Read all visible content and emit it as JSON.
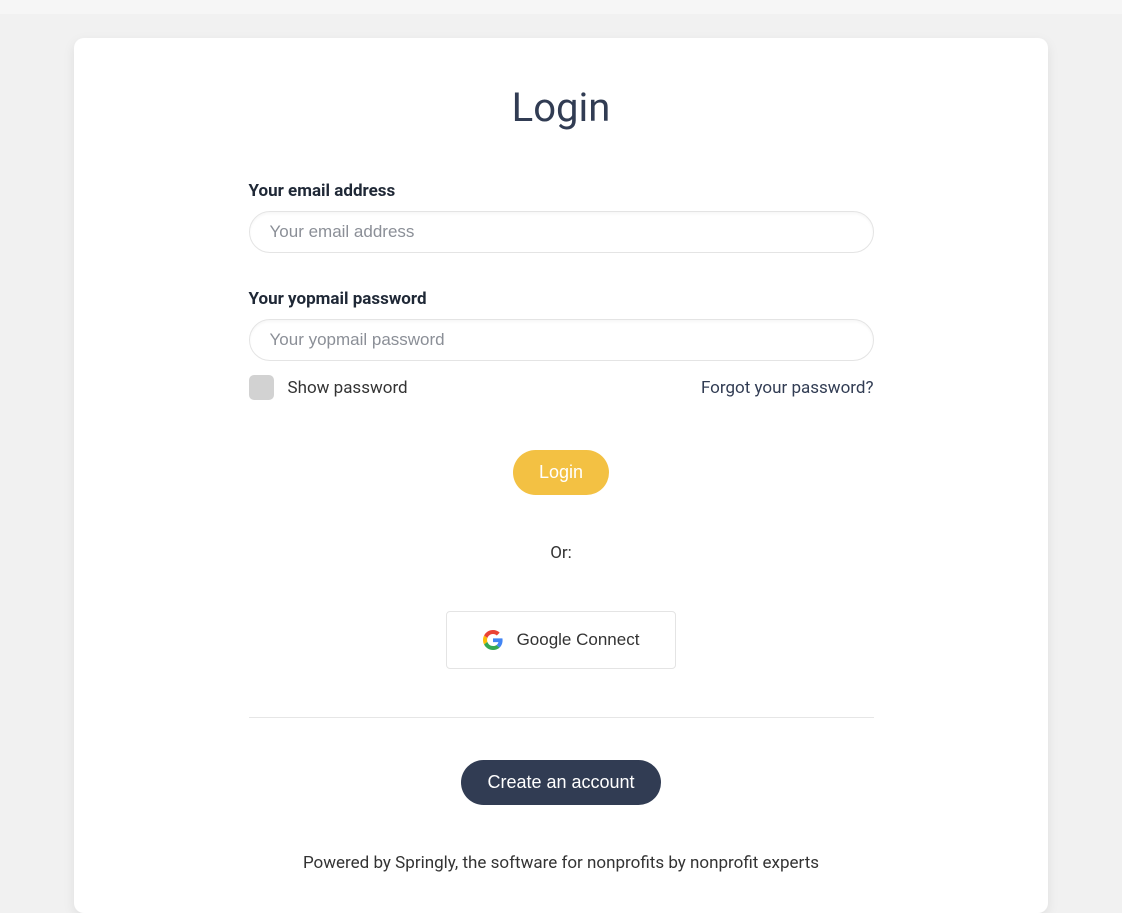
{
  "title": "Login",
  "form": {
    "email": {
      "label": "Your email address",
      "placeholder": "Your email address",
      "value": ""
    },
    "password": {
      "label": "Your yopmail password",
      "placeholder": "Your yopmail password",
      "value": ""
    },
    "show_password_label": "Show password",
    "forgot_password_label": "Forgot your password?",
    "login_button": "Login",
    "or_label": "Or:",
    "google_button": "Google Connect",
    "create_account_button": "Create an account",
    "footer_text": "Powered by Springly, the software for nonprofits by nonprofit experts"
  }
}
